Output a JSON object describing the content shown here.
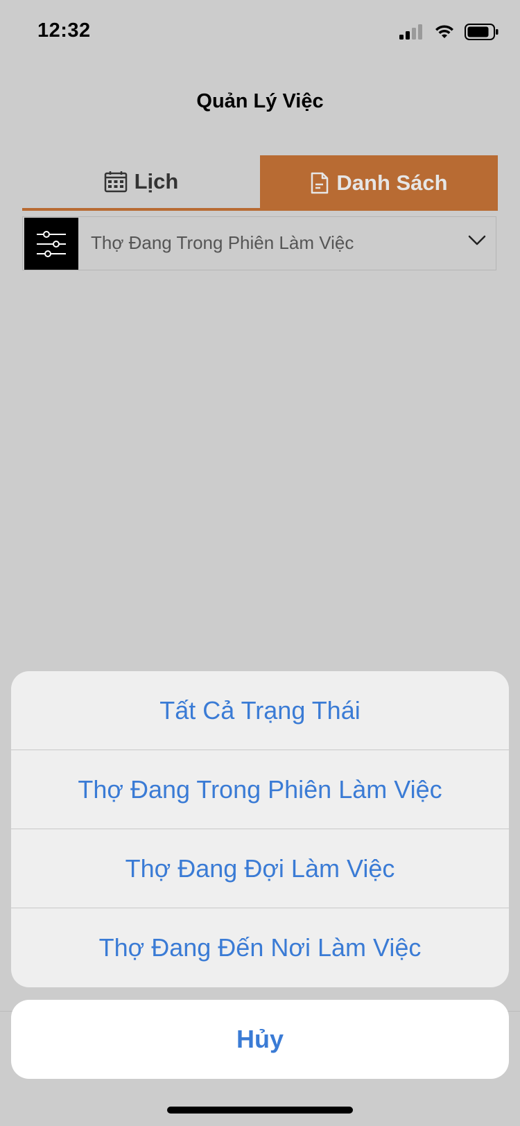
{
  "status_bar": {
    "time": "12:32"
  },
  "header": {
    "title": "Quản Lý Việc"
  },
  "tabs": [
    {
      "label": "Lịch",
      "icon": "calendar-icon",
      "active": false
    },
    {
      "label": "Danh Sách",
      "icon": "document-icon",
      "active": true
    }
  ],
  "filter": {
    "icon": "sliders-icon",
    "selected": "Thợ Đang Trong Phiên Làm Việc"
  },
  "action_sheet": {
    "options": [
      {
        "label": "Tất Cả Trạng Thái"
      },
      {
        "label": "Thợ Đang Trong Phiên Làm Việc"
      },
      {
        "label": "Thợ Đang Đợi Làm Việc"
      },
      {
        "label": "Thợ Đang Đến Nơi Làm Việc"
      }
    ],
    "cancel_label": "Hủy"
  },
  "colors": {
    "accent": "#b86b33",
    "link_blue": "#3a7bd5",
    "background": "#cccccc"
  }
}
